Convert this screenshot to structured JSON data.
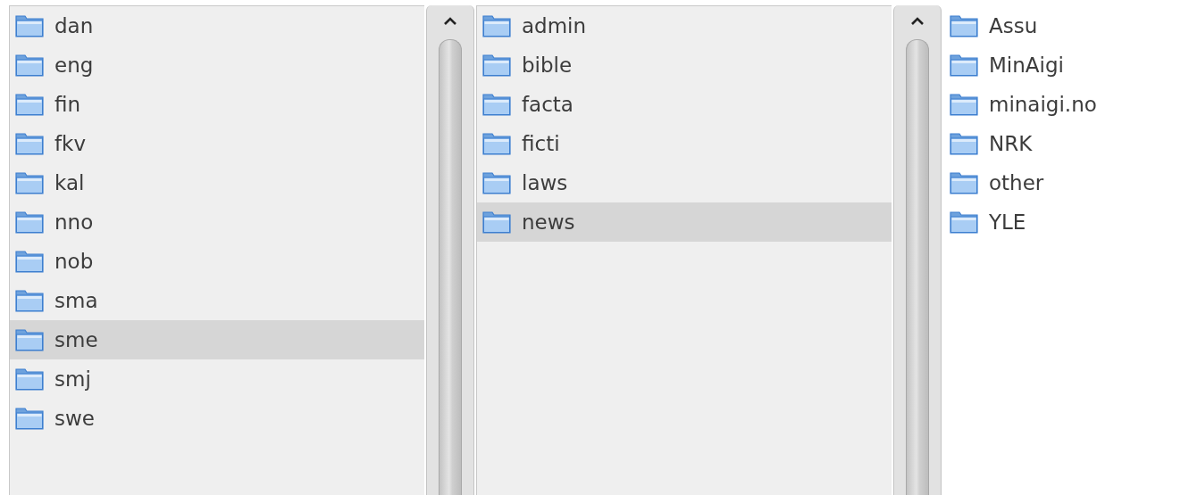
{
  "columns": [
    {
      "items": [
        {
          "label": "dan",
          "selected": false
        },
        {
          "label": "eng",
          "selected": false
        },
        {
          "label": "fin",
          "selected": false
        },
        {
          "label": "fkv",
          "selected": false
        },
        {
          "label": "kal",
          "selected": false
        },
        {
          "label": "nno",
          "selected": false
        },
        {
          "label": "nob",
          "selected": false
        },
        {
          "label": "sma",
          "selected": false
        },
        {
          "label": "sme",
          "selected": true
        },
        {
          "label": "smj",
          "selected": false
        },
        {
          "label": "swe",
          "selected": false
        }
      ]
    },
    {
      "items": [
        {
          "label": "admin",
          "selected": false
        },
        {
          "label": "bible",
          "selected": false
        },
        {
          "label": "facta",
          "selected": false
        },
        {
          "label": "ficti",
          "selected": false
        },
        {
          "label": "laws",
          "selected": false
        },
        {
          "label": "news",
          "selected": true
        }
      ]
    },
    {
      "items": [
        {
          "label": "Assu",
          "selected": false
        },
        {
          "label": "MinAigi",
          "selected": false
        },
        {
          "label": "minaigi.no",
          "selected": false
        },
        {
          "label": "NRK",
          "selected": false
        },
        {
          "label": "other",
          "selected": false
        },
        {
          "label": "YLE",
          "selected": false
        }
      ]
    }
  ]
}
